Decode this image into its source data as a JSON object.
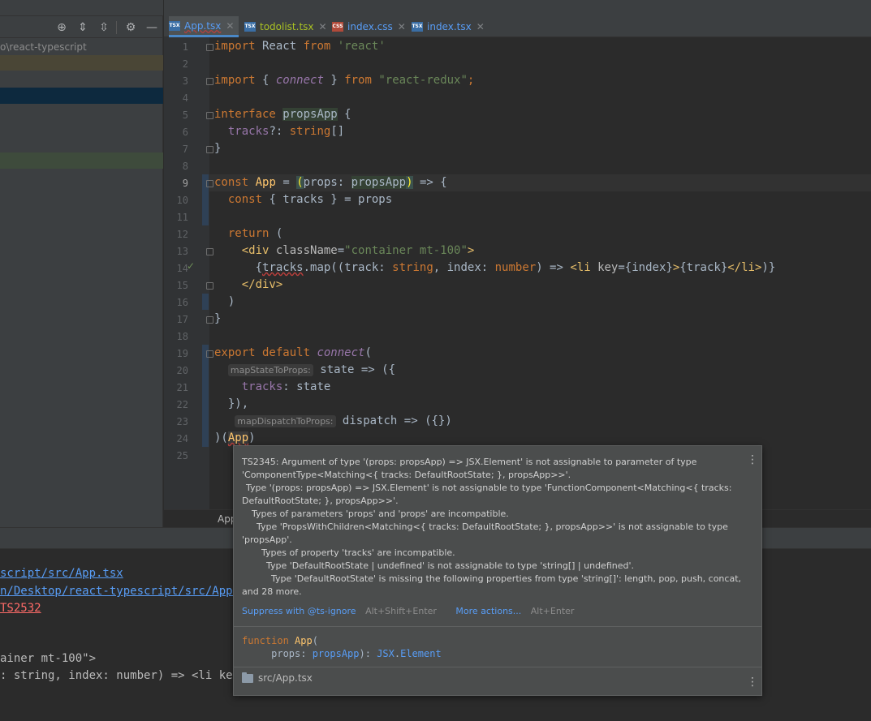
{
  "project": {
    "path_fragment": "o\\react-typescript"
  },
  "tabs": [
    {
      "label": "App.tsx",
      "icon": "tsx-file-icon",
      "color": "#589df6",
      "active": true
    },
    {
      "label": "todolist.tsx",
      "icon": "tsx-file-icon",
      "color": "#a8c023",
      "active": false
    },
    {
      "label": "index.css",
      "icon": "css-file-icon",
      "color": "#589df6",
      "active": false
    },
    {
      "label": "index.tsx",
      "icon": "tsx-file-icon",
      "color": "#589df6",
      "active": false
    }
  ],
  "editor": {
    "line_numbers": [
      "1",
      "2",
      "3",
      "4",
      "5",
      "6",
      "7",
      "8",
      "9",
      "10",
      "11",
      "12",
      "13",
      "14",
      "15",
      "16",
      "17",
      "18",
      "19",
      "20",
      "21",
      "22",
      "23",
      "24",
      "25"
    ],
    "current_line": "9",
    "hints": {
      "map_state": "mapStateToProps:",
      "map_dispatch": "mapDispatchToProps:"
    }
  },
  "breadcrumb": "App",
  "terminal": {
    "line1": "script/src/App.tsx",
    "line2": "n/Desktop/react-typescript/src/App.t",
    "line3": "TS2532",
    "line4": "ainer mt-100\">",
    "line5": ": string, index: number) => <li key="
  },
  "popup": {
    "message_lines": [
      "TS2345: Argument of type '(props: propsApp) => JSX.Element' is not assignable to parameter of type",
      "'ComponentType<Matching<{ tracks: DefaultRootState; }, propsApp>>'.",
      "  Type '(props: propsApp) => JSX.Element' is not assignable to type 'FunctionComponent<Matching<{ tracks:",
      "DefaultRootState; }, propsApp>>'.",
      "    Types of parameters 'props' and 'props' are incompatible.",
      "      Type 'PropsWithChildren<Matching<{ tracks: DefaultRootState; }, propsApp>>' is not assignable to type",
      "'propsApp'.",
      "        Types of property 'tracks' are incompatible.",
      "          Type 'DefaultRootState | undefined' is not assignable to type 'string[] | undefined'.",
      "            Type 'DefaultRootState' is missing the following properties from type 'string[]': length, pop, push, concat,",
      "and 28 more."
    ],
    "suppress_label": "Suppress with @ts-ignore",
    "suppress_shortcut": "Alt+Shift+Enter",
    "more_actions_label": "More actions...",
    "more_actions_shortcut": "Alt+Enter",
    "file_label": "src/App.tsx"
  }
}
